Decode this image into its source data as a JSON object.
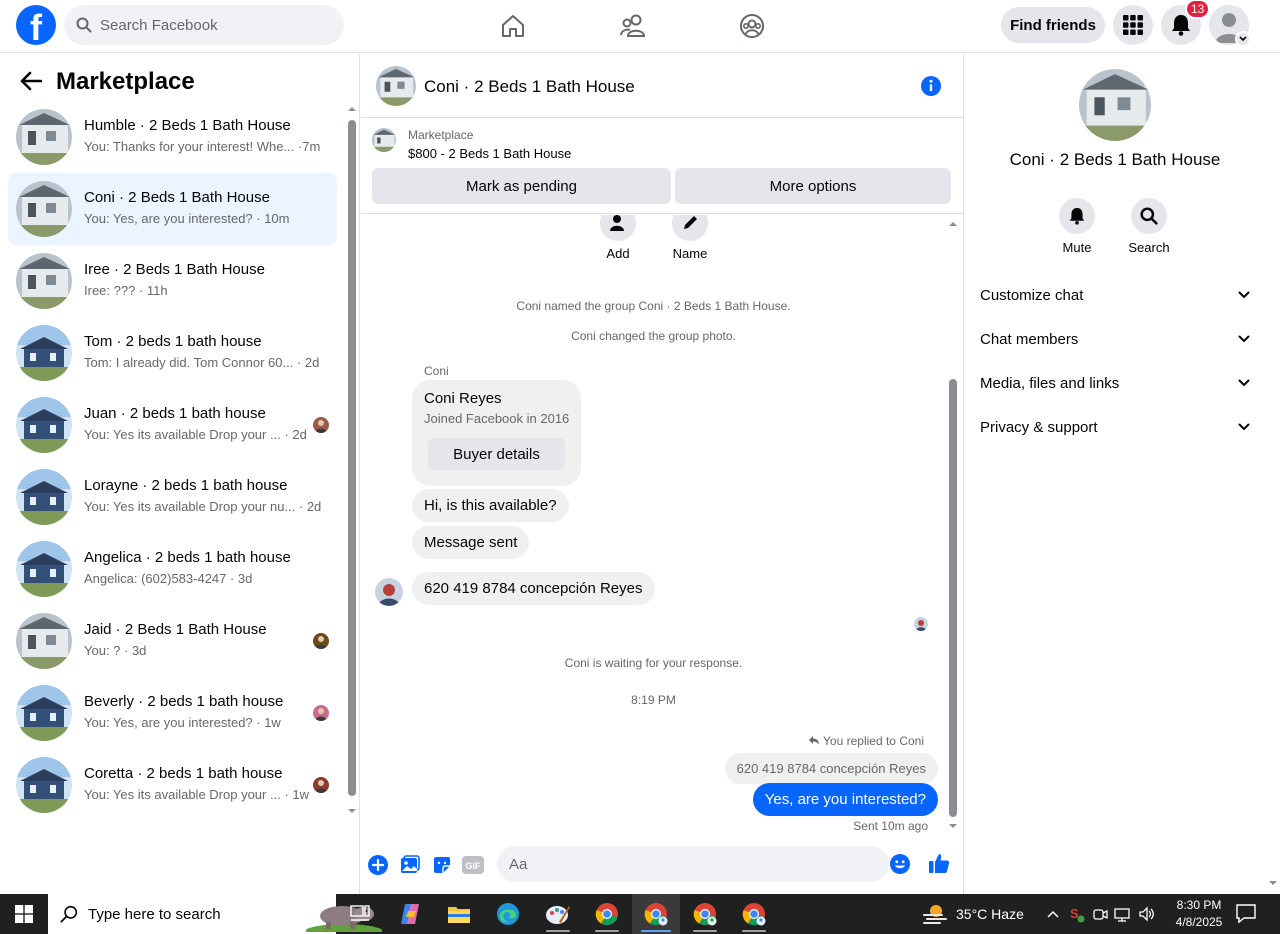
{
  "topbar": {
    "logo_letter": "f",
    "search_placeholder": "Search Facebook",
    "find_friends_label": "Find friends",
    "notification_count": "13"
  },
  "sidebar": {
    "title": "Marketplace",
    "conversations": [
      {
        "title": "Humble · 2 Beds 1 Bath House",
        "preview": "You: Thanks for your interest! Whe... ·7m",
        "thumb": "white-house"
      },
      {
        "title": "Coni · 2 Beds 1 Bath House",
        "preview": "You: Yes, are you interested? · 10m",
        "thumb": "white-house"
      },
      {
        "title": "Iree · 2 Beds 1 Bath House",
        "preview": "Iree: ??? · 11h",
        "thumb": "white-house"
      },
      {
        "title": "Tom · 2 beds 1 bath house",
        "preview": "Tom: I already did. Tom Connor 60...  · 2d",
        "thumb": "blue-house"
      },
      {
        "title": "Juan · 2 beds 1 bath house",
        "preview": "You: Yes its available Drop your ...  · 2d",
        "thumb": "blue-house"
      },
      {
        "title": "Lorayne · 2 beds 1 bath house",
        "preview": "You: Yes its available Drop your nu...  · 2d",
        "thumb": "blue-house"
      },
      {
        "title": "Angelica · 2 beds 1 bath house",
        "preview": "Angelica: (602)583-4247 · 3d",
        "thumb": "blue-house"
      },
      {
        "title": "Jaid · 2 Beds 1 Bath House",
        "preview": "You: ? · 3d",
        "thumb": "white-house"
      },
      {
        "title": "Beverly · 2 beds 1 bath house",
        "preview": "You: Yes, are you interested? · 1w",
        "thumb": "blue-house"
      },
      {
        "title": "Coretta · 2 beds 1 bath house",
        "preview": "You: Yes its available Drop your ...  · 1w",
        "thumb": "blue-house"
      }
    ]
  },
  "chat": {
    "title": "Coni · 2 Beds 1 Bath House",
    "listing_label": "Marketplace",
    "listing_price": "$800 - 2 Beds 1 Bath House",
    "mark_pending_label": "Mark as pending",
    "more_options_label": "More options",
    "quick_add_label": "Add",
    "quick_name_label": "Name",
    "sys_named": "Coni named the group Coni · 2 Beds 1 Bath House.",
    "sys_photo": "Coni changed the group photo.",
    "sender_name": "Coni",
    "card_name": "Coni Reyes",
    "card_sub": "Joined Facebook in 2016",
    "card_button": "Buyer details",
    "msg_1": "Hi, is this available?",
    "msg_2": "Message sent",
    "msg_3": "620 419 8784 concepción Reyes",
    "sys_waiting": "Coni is waiting for your response.",
    "timestamp": "8:19 PM",
    "reply_label": "You replied to Coni",
    "quoted_text": "620 419 8784 concepción Reyes",
    "own_message": "Yes, are you interested?",
    "sent_status": "Sent 10m ago",
    "composer_placeholder": "Aa"
  },
  "right_panel": {
    "title": "Coni · 2 Beds 1 Bath House",
    "mute_label": "Mute",
    "search_label": "Search",
    "sections": [
      "Customize chat",
      "Chat members",
      "Media, files and links",
      "Privacy & support"
    ]
  },
  "taskbar": {
    "search_placeholder": "Type here to search",
    "weather": "35°C  Haze",
    "time": "8:30 PM",
    "date": "4/8/2025"
  },
  "colors": {
    "brand_blue": "#0866ff",
    "active_bg": "#ebf5ff",
    "badge_red": "#e41e3f",
    "taskbar": "#202020"
  }
}
